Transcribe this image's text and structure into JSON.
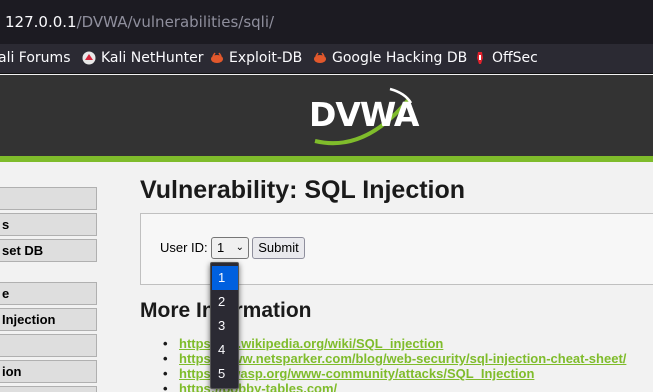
{
  "browser": {
    "url_host": "127.0.0.1",
    "url_path": "/DVWA/vulnerabilities/sqli/"
  },
  "bookmarks": [
    {
      "label": "ali Forums",
      "icon": "kali-icon"
    },
    {
      "label": "Kali NetHunter",
      "icon": "kali-nethunter-icon"
    },
    {
      "label": "Exploit-DB",
      "icon": "exploit-db-icon"
    },
    {
      "label": "Google Hacking DB",
      "icon": "ghdb-icon"
    },
    {
      "label": "OffSec",
      "icon": "offsec-icon"
    }
  ],
  "header": {
    "logo_text": "DVWA",
    "accent_color": "#7fbc2b"
  },
  "menu": [
    {
      "label": ""
    },
    {
      "label": "s"
    },
    {
      "label": "set DB"
    },
    {
      "label": "e"
    },
    {
      "label": "Injection"
    },
    {
      "label": ""
    },
    {
      "label": "ion"
    }
  ],
  "main": {
    "title": "Vulnerability: SQL Injection",
    "user_id_label": "User ID:",
    "user_id_value": "1",
    "submit_label": "Submit",
    "more_info_title": "More Information",
    "links": [
      "https://en.wikipedia.org/wiki/SQL_injection",
      "https://www.netsparker.com/blog/web-security/sql-injection-cheat-sheet/",
      "https://owasp.org/www-community/attacks/SQL_Injection",
      "https://bobby-tables.com/"
    ],
    "links_visible": [
      "https://en.wikipedia.org/wiki/SQL_injection",
      "https://www.netsparker.com/blog/web-security/sql-injection-cheat-sheet/",
      "https://owasp.org/www-community/attacks/SQL_Injection",
      "https://bobby-tables.com/"
    ]
  },
  "dropdown": {
    "options": [
      "1",
      "2",
      "3",
      "4",
      "5"
    ],
    "selected": "1"
  }
}
